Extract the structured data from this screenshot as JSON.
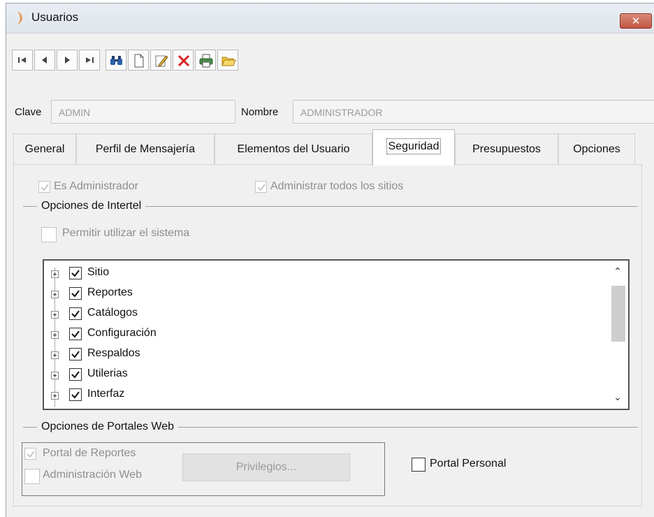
{
  "window": {
    "title": "Usuarios",
    "close_label": "✕"
  },
  "toolbar": {
    "buttons": [
      "first-record",
      "previous-record",
      "next-record",
      "last-record",
      "find",
      "new",
      "edit",
      "delete",
      "print",
      "open"
    ]
  },
  "form": {
    "clave_label": "Clave",
    "clave_value": "ADMIN",
    "nombre_label": "Nombre",
    "nombre_value": "ADMINISTRADOR"
  },
  "tabs": [
    {
      "label": "General"
    },
    {
      "label": "Perfil de Mensajería"
    },
    {
      "label": "Elementos del Usuario"
    },
    {
      "label": "Seguridad"
    },
    {
      "label": "Presupuestos"
    },
    {
      "label": "Opciones"
    }
  ],
  "active_tab": "Seguridad",
  "security": {
    "es_administrador": {
      "label": "Es Administrador",
      "checked": true,
      "enabled": false
    },
    "administrar_sitios": {
      "label": "Administrar todos los sitios",
      "checked": true,
      "enabled": false
    },
    "intertel_group": "Opciones de Intertel",
    "permitir_sistema": {
      "label": "Permitir utilizar el sistema",
      "checked": false,
      "enabled": false
    },
    "tree_items": [
      {
        "label": "Sitio",
        "checked": true
      },
      {
        "label": "Reportes",
        "checked": true
      },
      {
        "label": "Catálogos",
        "checked": true
      },
      {
        "label": "Configuración",
        "checked": true
      },
      {
        "label": "Respaldos",
        "checked": true
      },
      {
        "label": "Utilerias",
        "checked": true
      },
      {
        "label": "Interfaz",
        "checked": true
      }
    ],
    "portales_group": "Opciones de Portales Web",
    "portal_reportes": {
      "label": "Portal de Reportes",
      "checked": true,
      "enabled": false
    },
    "administracion_web": {
      "label": "Administración Web",
      "checked": false,
      "enabled": false
    },
    "privilegios_label": "Privilegios...",
    "portal_personal": {
      "label": "Portal Personal",
      "checked": false,
      "enabled": true
    }
  },
  "colors": {
    "window_bg": "#f0f0f0",
    "close_red": "#c35641",
    "disabled_text": "#8e8e8e"
  }
}
